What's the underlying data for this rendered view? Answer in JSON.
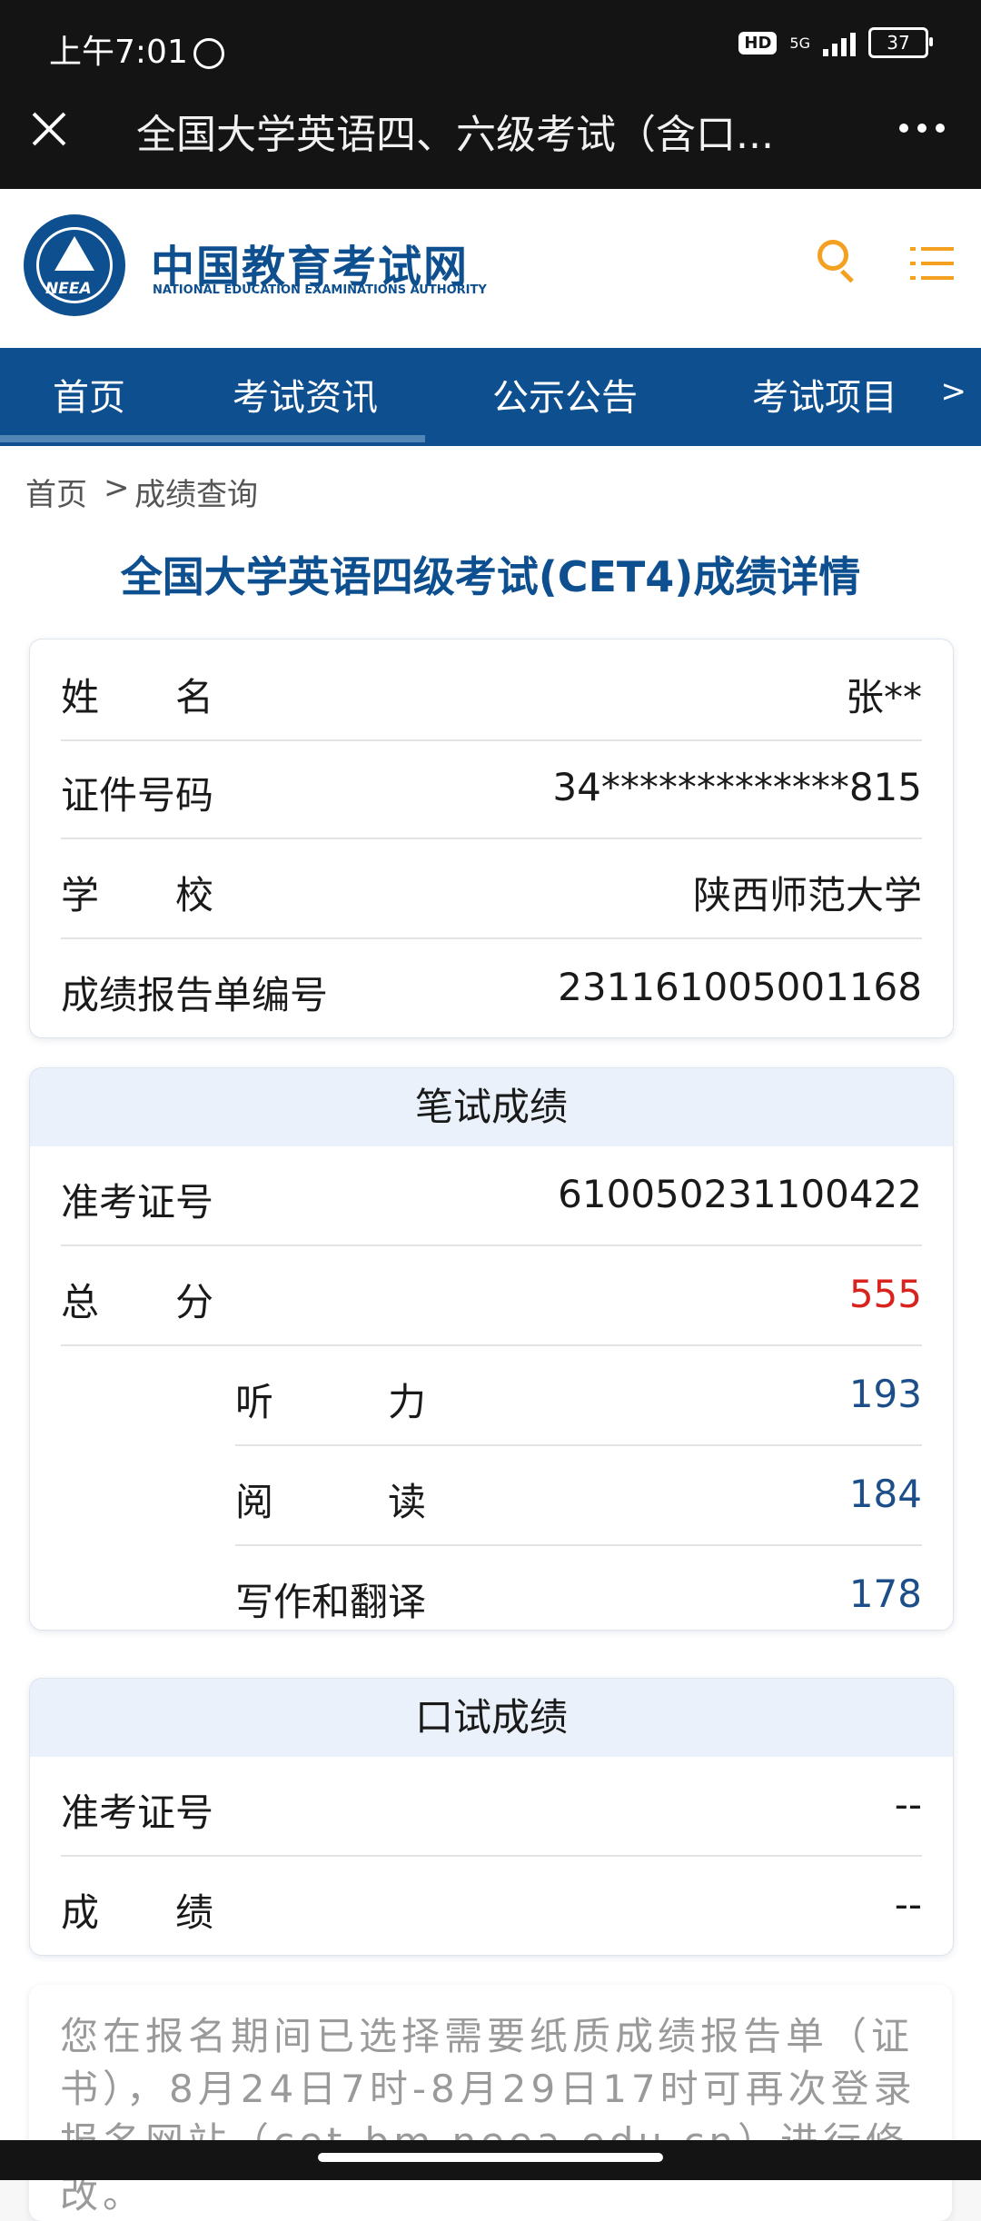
{
  "status_bar": {
    "time": "上午7:01",
    "hd": "HD",
    "network": "5G",
    "battery": "37"
  },
  "wechat_header": {
    "title": "全国大学英语四、六级考试（含口..."
  },
  "site": {
    "logo_cn": "中国教育考试网",
    "logo_en": "NATIONAL EDUCATION EXAMINATIONS AUTHORITY",
    "logo_mark": "NEEA",
    "brand_color": "#0d4f8f",
    "accent_color": "#f4a020"
  },
  "nav": {
    "items": [
      "首页",
      "考试资讯",
      "公示公告",
      "考试项目"
    ],
    "more": ">"
  },
  "breadcrumb": {
    "home": "首页",
    "sep": ">",
    "current": "成绩查询"
  },
  "page_title": "全国大学英语四级考试(CET4)成绩详情",
  "info": {
    "name_label": "姓　　名",
    "name_value": "张**",
    "id_label": "证件号码",
    "id_value": "34*************815",
    "school_label": "学　　校",
    "school_value": "陕西师范大学",
    "report_label": "成绩报告单编号",
    "report_value": "231161005001168"
  },
  "written": {
    "heading": "笔试成绩",
    "ticket_label": "准考证号",
    "ticket_value": "610050231100422",
    "total_label": "总　　分",
    "total_value": "555",
    "listening_label": "听　　　力",
    "listening_value": "193",
    "reading_label": "阅　　　读",
    "reading_value": "184",
    "writing_label": "写作和翻译",
    "writing_value": "178"
  },
  "oral": {
    "heading": "口试成绩",
    "ticket_label": "准考证号",
    "ticket_value": "--",
    "score_label": "成　　绩",
    "score_value": "--"
  },
  "notice": "您在报名期间已选择需要纸质成绩报告单（证书），8月24日7时-8月29日17时可再次登录报名网站（cet-bm.neea.edu.cn）进行修改。"
}
